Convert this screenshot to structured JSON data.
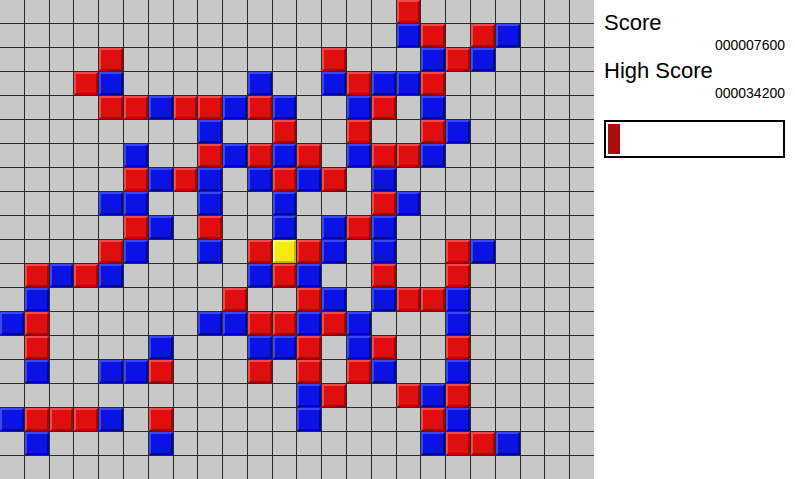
{
  "board": {
    "columns": 24,
    "legend": {
      ".": "empty",
      "R": "red",
      "B": "blue",
      "Y": "yellow"
    },
    "rows": [
      "................R.......",
      "................BR.RB...",
      "....R........R...BRB....",
      "...RB.....B..BRBBR......",
      "....RRBRRBRB..BR.B......",
      "........B..R..R..RB.....",
      ".....B..RBRBR.BRRB......",
      ".....RBRB.BRBR.B........",
      "....BB..B..B...RB.......",
      ".....RB.R..B.BRB........",
      "....RB..B.RYRB.B..RB....",
      ".RBRB.....BRB..R..R.....",
      ".B.......R..RB.BRRB.....",
      "BR......BBRRBRB...B.....",
      ".R....B...BBR.BR..R.....",
      ".B..BBR...R.R.RB..B.....",
      "............BR..RBR.....",
      "BRRRB.R.....B....RB.....",
      ".B....B..........BRRB...",
      "........................"
    ]
  },
  "score": {
    "label": "Score",
    "value": "000007600"
  },
  "high_score": {
    "label": "High Score",
    "value": "000034200"
  },
  "progress": {
    "level": 0.07
  }
}
